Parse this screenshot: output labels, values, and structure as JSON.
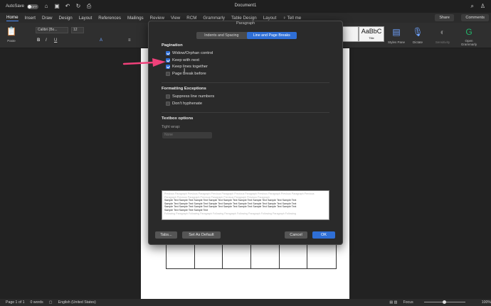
{
  "titlebar": {
    "autosave_label": "AutoSave",
    "autosave_state": "OFF",
    "doc_title": "Document1"
  },
  "tabs": [
    {
      "label": "Home",
      "active": true
    },
    {
      "label": "Insert"
    },
    {
      "label": "Draw"
    },
    {
      "label": "Design"
    },
    {
      "label": "Layout"
    },
    {
      "label": "References"
    },
    {
      "label": "Mailings"
    },
    {
      "label": "Review"
    },
    {
      "label": "View"
    },
    {
      "label": "RCM"
    },
    {
      "label": "Grammarly"
    },
    {
      "label": "Table Design"
    },
    {
      "label": "Layout"
    },
    {
      "label": "Tell me"
    }
  ],
  "header_buttons": {
    "share": "Share",
    "comments": "Comments"
  },
  "ribbon": {
    "paste_label": "Paste",
    "font_name": "Calibri (Bo...",
    "font_size": "12",
    "style_title_sample": "AaBbC",
    "style_title_label": "Title",
    "styles_pane_label": "Styles Pane",
    "dictate_label": "Dictate",
    "sensitivity_label": "Sensitivity",
    "grammarly_label": "Open Grammarly"
  },
  "dialog": {
    "title": "Paragraph",
    "tabs": [
      "Indents and Spacing",
      "Line and Page Breaks"
    ],
    "active_tab": 1,
    "pagination": {
      "heading": "Pagination",
      "options": [
        {
          "label": "Widow/Orphan control",
          "checked": true
        },
        {
          "label": "Keep with next",
          "checked": true
        },
        {
          "label": "Keep lines together",
          "checked": true
        },
        {
          "label": "Page break before",
          "checked": false
        }
      ]
    },
    "formatting": {
      "heading": "Formatting Exceptions",
      "options": [
        {
          "label": "Suppress line numbers",
          "checked": false
        },
        {
          "label": "Don't hyphenate",
          "checked": false
        }
      ]
    },
    "textbox": {
      "heading": "Textbox options",
      "tight_wrap_label": "Tight wrap:",
      "tight_wrap_value": "None"
    },
    "preview": {
      "grey_lines": [
        "Previous Paragraph Previous Paragraph Previous Paragraph Previous Paragraph Previous Paragraph Previous Paragraph Previous",
        "Paragraph Previous Paragraph Previous Paragraph Previous Paragraph Previous Paragraph"
      ],
      "sample_lines": [
        "Sample Text Sample Text Sample Text Sample Text Sample Text Sample Text Sample Text Sample Text Sample Text",
        "Sample Text Sample Text Sample Text Sample Text Sample Text Sample Text Sample Text Sample Text Sample Text",
        "Sample Text Sample Text Sample Text Sample Text Sample Text Sample Text Sample Text Sample Text Sample Text",
        "Sample Text Sample Text Sample Text"
      ],
      "following_lines": [
        "Following Paragraph Following Paragraph Following Paragraph Following Paragraph Following Paragraph Following"
      ]
    },
    "buttons": {
      "tabs": "Tabs...",
      "set_default": "Set As Default",
      "cancel": "Cancel",
      "ok": "OK"
    }
  },
  "status": {
    "page": "Page 1 of 1",
    "words": "0 words",
    "language": "English (United States)",
    "focus": "Focus",
    "zoom": "100%"
  },
  "colors": {
    "accent": "#2f6fd6",
    "arrow": "#f0417a",
    "dialog_bg": "#2a2a2a"
  },
  "icons": [
    "home-icon",
    "save-icon",
    "undo-icon",
    "redo-icon",
    "print-icon",
    "search-icon",
    "person-icon",
    "arrow-pointer",
    "text-cursor-icon"
  ]
}
